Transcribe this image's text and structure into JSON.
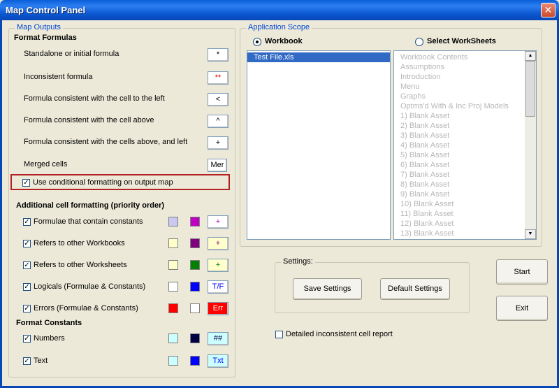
{
  "window": {
    "title": "Map Control Panel"
  },
  "map_outputs": {
    "legend": "Map Outputs",
    "format_formulas_heading": "Format Formulas",
    "formula_rows": [
      {
        "label": "Standalone or initial formula",
        "button": "*",
        "button_color": "#000000"
      },
      {
        "label": "Inconsistent formula",
        "button": "**",
        "button_color": "#e00000"
      },
      {
        "label": "Formula consistent with the cell to the left",
        "button": "<",
        "button_color": "#000000"
      },
      {
        "label": "Formula consistent with the cell above",
        "button": "^",
        "button_color": "#000000"
      },
      {
        "label": "Formula consistent with the cells above, and  left",
        "button": "+",
        "button_color": "#000000"
      },
      {
        "label": "Merged cells",
        "button": "Mer",
        "button_color": "#000000"
      }
    ],
    "conditional_formatting": {
      "label": "Use conditional formatting on output map",
      "checked": true
    },
    "additional_heading": "Additional cell formatting (priority order)",
    "additional_rows": [
      {
        "label": "Formulae that contain constants",
        "checked": true,
        "fill": "#c8c8f0",
        "font": "#c000c0",
        "sample": "+",
        "sample_bg": "#ffffff",
        "sample_fg": "#c000c0"
      },
      {
        "label": "Refers to other Workbooks",
        "checked": true,
        "fill": "#ffffcc",
        "font": "#800080",
        "sample": "+",
        "sample_bg": "#ffffcc",
        "sample_fg": "#800080"
      },
      {
        "label": "Refers to other Worksheets",
        "checked": true,
        "fill": "#ffffcc",
        "font": "#008000",
        "sample": "+",
        "sample_bg": "#ffffcc",
        "sample_fg": "#008000"
      },
      {
        "label": "Logicals (Formulae & Constants)",
        "checked": true,
        "fill": "#ffffff",
        "font": "#0000ff",
        "sample": "T/F",
        "sample_bg": "#ffffff",
        "sample_fg": "#0000ff"
      },
      {
        "label": "Errors (Formulae & Constants)",
        "checked": true,
        "fill": "#ff0000",
        "font": "#ffffff",
        "sample": "Err",
        "sample_bg": "#ff0000",
        "sample_fg": "#ffffff"
      }
    ],
    "constants_heading": "Format Constants",
    "constants_rows": [
      {
        "label": "Numbers",
        "checked": true,
        "fill": "#ccffff",
        "font": "#000040",
        "sample": "##",
        "sample_bg": "#ccffff",
        "sample_fg": "#000040"
      },
      {
        "label": "Text",
        "checked": true,
        "fill": "#ccffff",
        "font": "#0000ff",
        "sample": "Txt",
        "sample_bg": "#ccffff",
        "sample_fg": "#0000ff"
      }
    ]
  },
  "application_scope": {
    "legend": "Application Scope",
    "workbook_label": "Workbook",
    "worksheets_label": "Select WorkSheets",
    "selected_mode": "workbook",
    "files": [
      "Test File.xls"
    ],
    "selected_file": "Test File.xls",
    "worksheets": [
      "Workbook Contents",
      "Assumptions",
      "Introduction",
      "Menu",
      "Graphs",
      "Optms'd With & Inc Proj Models",
      "1) Blank Asset",
      "2) Blank Asset",
      "3) Blank Asset",
      "4) Blank Asset",
      "5) Blank Asset",
      "6) Blank Asset",
      "7) Blank Asset",
      "8) Blank Asset",
      "9) Blank Asset",
      "10) Blank Asset",
      "11) Blank Asset",
      "12) Blank Asset",
      "13) Blank Asset"
    ]
  },
  "settings": {
    "legend": "Settings:",
    "save_label": "Save Settings",
    "default_label": "Default  Settings"
  },
  "actions": {
    "start_label": "Start",
    "exit_label": "Exit"
  },
  "detailed_report": {
    "label": "Detailed inconsistent cell report",
    "checked": false
  }
}
